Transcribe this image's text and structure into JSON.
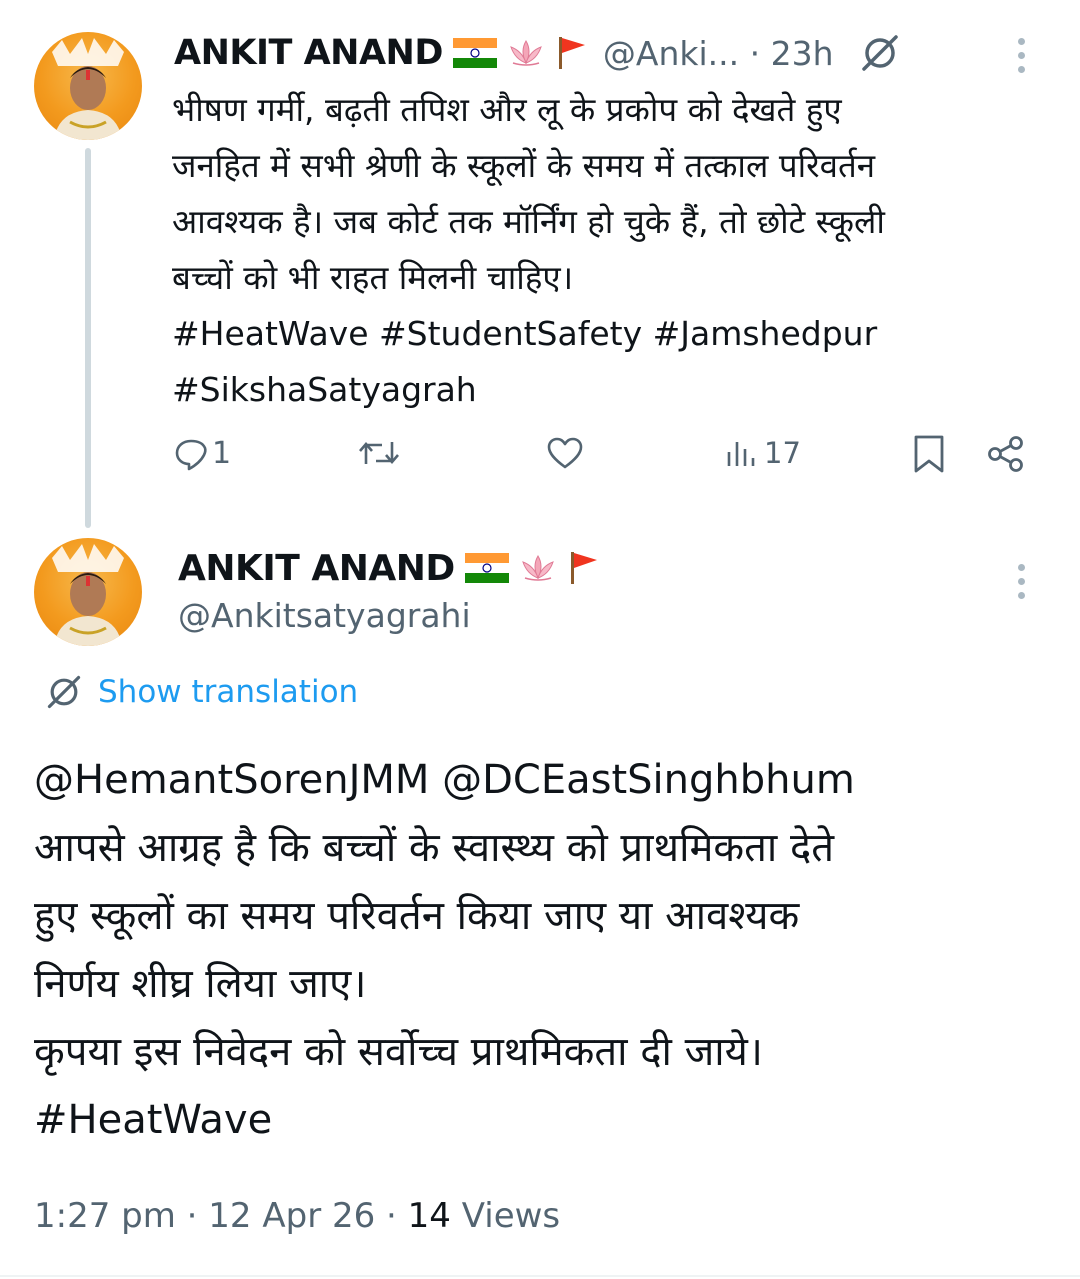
{
  "tweet1": {
    "author_name": "ANKIT ANAND",
    "handle_time": "@Anki... · 23h",
    "text": [
      "भीषण गर्मी, बढ़ती तपिश और लू के प्रकोप को देखते हुए",
      "जनहित में सभी श्रेणी के स्कूलों के समय में तत्काल परिवर्तन",
      "आवश्यक है। जब कोर्ट तक मॉर्निंग हो चुके हैं, तो छोटे स्कूली",
      "बच्चों को भी राहत मिलनी चाहिए।"
    ],
    "hashtags_line1": "#HeatWave #StudentSafety #Jamshedpur",
    "hashtags_line2": "#SikshaSatyagrah",
    "reply_count": "1",
    "views_count": "17"
  },
  "tweet2": {
    "author_name": "ANKIT ANAND",
    "handle": "@Ankitsatyagrahi",
    "show_translation": "Show translation",
    "mentions": "@HemantSorenJMM @DCEastSinghbhum",
    "text": [
      "आपसे आग्रह है कि बच्चों के स्वास्थ्य को प्राथमिकता देते",
      "हुए स्कूलों का समय परिवर्तन किया जाए या आवश्यक",
      "निर्णय शीघ्र लिया जाए।",
      "कृपया इस निवेदन को सर्वोच्च प्राथमिकता दी जाये।"
    ],
    "hashtag": "#HeatWave",
    "timestamp": "1:27 pm · 12 Apr 26 · ",
    "views_number": "14",
    "views_label": " Views"
  },
  "colors": {
    "link": "#1d9bf0",
    "muted": "#536471",
    "text": "#0f1419",
    "thread_line": "#cfd9de"
  },
  "icons": [
    "reply-icon",
    "retweet-icon",
    "like-icon",
    "views-icon",
    "bookmark-icon",
    "share-icon",
    "translate-icon",
    "more-icon",
    "india-flag-icon",
    "lotus-icon",
    "saffron-flag-icon"
  ]
}
